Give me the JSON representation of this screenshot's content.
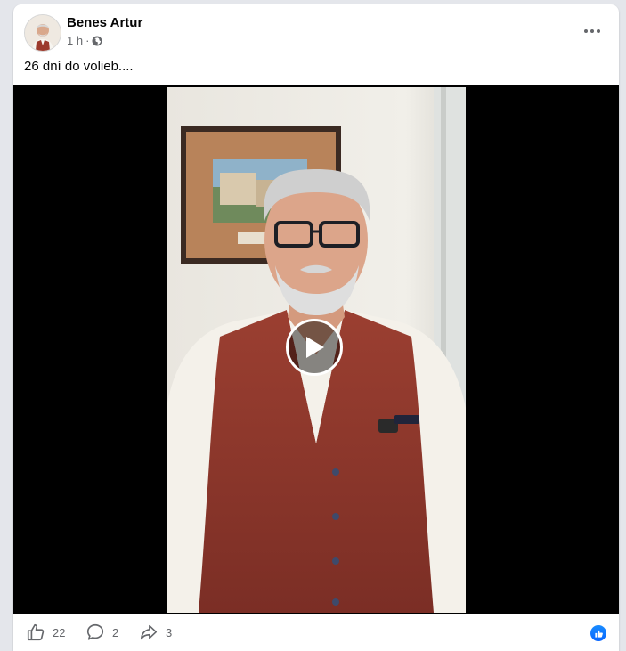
{
  "post": {
    "author": "Benes Artur",
    "time": "1 h",
    "separator": "·",
    "text": "26 dní do volieb...."
  },
  "reactions": {
    "likes": "22",
    "comments": "2",
    "shares": "3"
  },
  "icons": {
    "audience": "globe-icon",
    "more": "more-icon",
    "play": "play-icon",
    "like": "like-icon",
    "comment": "comment-icon",
    "share": "share-icon",
    "reaction_badge": "like-reaction-icon"
  },
  "colors": {
    "accent": "#0866ff",
    "secondary_text": "#65676b",
    "primary_text": "#050505"
  }
}
